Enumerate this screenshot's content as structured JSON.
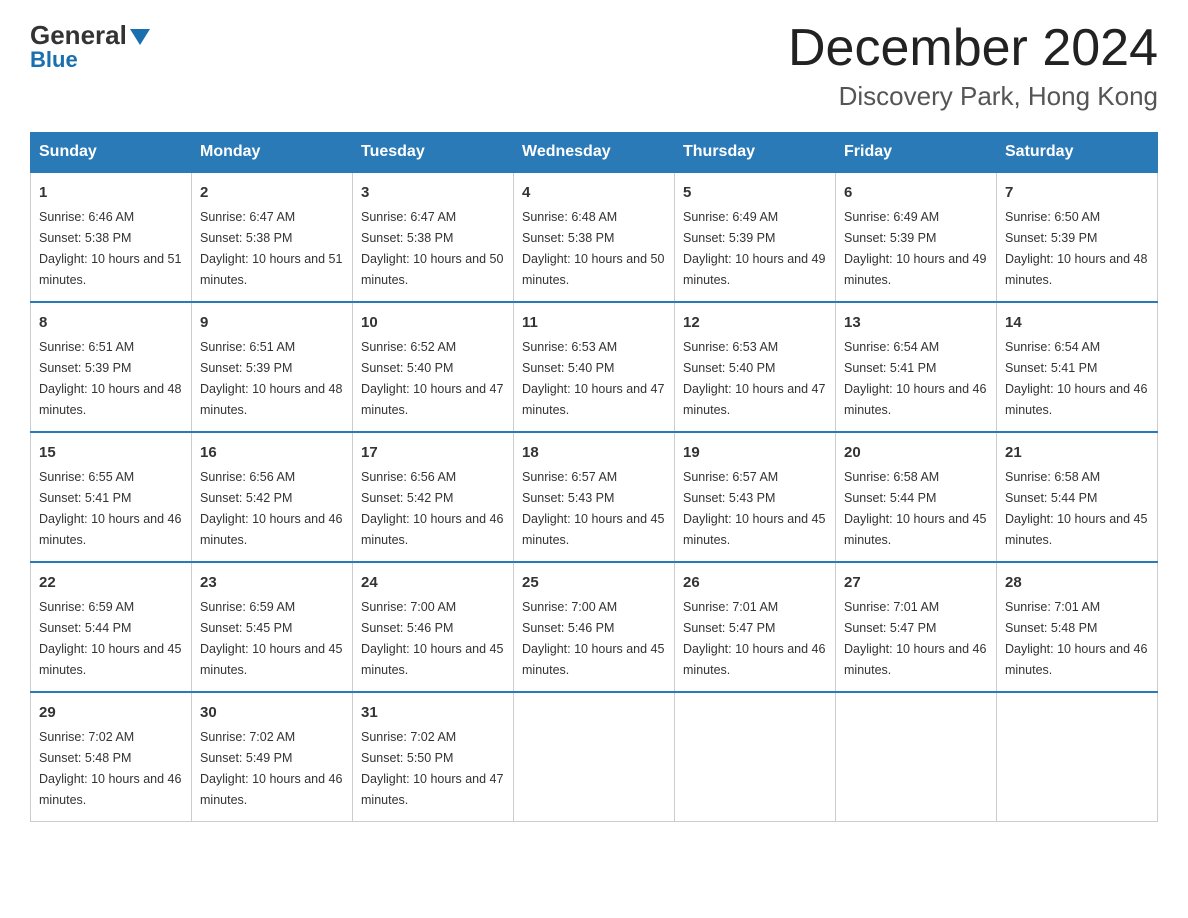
{
  "header": {
    "logo": {
      "general": "General",
      "blue": "Blue"
    },
    "title": "December 2024",
    "location": "Discovery Park, Hong Kong"
  },
  "days_of_week": [
    "Sunday",
    "Monday",
    "Tuesday",
    "Wednesday",
    "Thursday",
    "Friday",
    "Saturday"
  ],
  "weeks": [
    [
      {
        "day": "1",
        "sunrise": "6:46 AM",
        "sunset": "5:38 PM",
        "daylight": "10 hours and 51 minutes."
      },
      {
        "day": "2",
        "sunrise": "6:47 AM",
        "sunset": "5:38 PM",
        "daylight": "10 hours and 51 minutes."
      },
      {
        "day": "3",
        "sunrise": "6:47 AM",
        "sunset": "5:38 PM",
        "daylight": "10 hours and 50 minutes."
      },
      {
        "day": "4",
        "sunrise": "6:48 AM",
        "sunset": "5:38 PM",
        "daylight": "10 hours and 50 minutes."
      },
      {
        "day": "5",
        "sunrise": "6:49 AM",
        "sunset": "5:39 PM",
        "daylight": "10 hours and 49 minutes."
      },
      {
        "day": "6",
        "sunrise": "6:49 AM",
        "sunset": "5:39 PM",
        "daylight": "10 hours and 49 minutes."
      },
      {
        "day": "7",
        "sunrise": "6:50 AM",
        "sunset": "5:39 PM",
        "daylight": "10 hours and 48 minutes."
      }
    ],
    [
      {
        "day": "8",
        "sunrise": "6:51 AM",
        "sunset": "5:39 PM",
        "daylight": "10 hours and 48 minutes."
      },
      {
        "day": "9",
        "sunrise": "6:51 AM",
        "sunset": "5:39 PM",
        "daylight": "10 hours and 48 minutes."
      },
      {
        "day": "10",
        "sunrise": "6:52 AM",
        "sunset": "5:40 PM",
        "daylight": "10 hours and 47 minutes."
      },
      {
        "day": "11",
        "sunrise": "6:53 AM",
        "sunset": "5:40 PM",
        "daylight": "10 hours and 47 minutes."
      },
      {
        "day": "12",
        "sunrise": "6:53 AM",
        "sunset": "5:40 PM",
        "daylight": "10 hours and 47 minutes."
      },
      {
        "day": "13",
        "sunrise": "6:54 AM",
        "sunset": "5:41 PM",
        "daylight": "10 hours and 46 minutes."
      },
      {
        "day": "14",
        "sunrise": "6:54 AM",
        "sunset": "5:41 PM",
        "daylight": "10 hours and 46 minutes."
      }
    ],
    [
      {
        "day": "15",
        "sunrise": "6:55 AM",
        "sunset": "5:41 PM",
        "daylight": "10 hours and 46 minutes."
      },
      {
        "day": "16",
        "sunrise": "6:56 AM",
        "sunset": "5:42 PM",
        "daylight": "10 hours and 46 minutes."
      },
      {
        "day": "17",
        "sunrise": "6:56 AM",
        "sunset": "5:42 PM",
        "daylight": "10 hours and 46 minutes."
      },
      {
        "day": "18",
        "sunrise": "6:57 AM",
        "sunset": "5:43 PM",
        "daylight": "10 hours and 45 minutes."
      },
      {
        "day": "19",
        "sunrise": "6:57 AM",
        "sunset": "5:43 PM",
        "daylight": "10 hours and 45 minutes."
      },
      {
        "day": "20",
        "sunrise": "6:58 AM",
        "sunset": "5:44 PM",
        "daylight": "10 hours and 45 minutes."
      },
      {
        "day": "21",
        "sunrise": "6:58 AM",
        "sunset": "5:44 PM",
        "daylight": "10 hours and 45 minutes."
      }
    ],
    [
      {
        "day": "22",
        "sunrise": "6:59 AM",
        "sunset": "5:44 PM",
        "daylight": "10 hours and 45 minutes."
      },
      {
        "day": "23",
        "sunrise": "6:59 AM",
        "sunset": "5:45 PM",
        "daylight": "10 hours and 45 minutes."
      },
      {
        "day": "24",
        "sunrise": "7:00 AM",
        "sunset": "5:46 PM",
        "daylight": "10 hours and 45 minutes."
      },
      {
        "day": "25",
        "sunrise": "7:00 AM",
        "sunset": "5:46 PM",
        "daylight": "10 hours and 45 minutes."
      },
      {
        "day": "26",
        "sunrise": "7:01 AM",
        "sunset": "5:47 PM",
        "daylight": "10 hours and 46 minutes."
      },
      {
        "day": "27",
        "sunrise": "7:01 AM",
        "sunset": "5:47 PM",
        "daylight": "10 hours and 46 minutes."
      },
      {
        "day": "28",
        "sunrise": "7:01 AM",
        "sunset": "5:48 PM",
        "daylight": "10 hours and 46 minutes."
      }
    ],
    [
      {
        "day": "29",
        "sunrise": "7:02 AM",
        "sunset": "5:48 PM",
        "daylight": "10 hours and 46 minutes."
      },
      {
        "day": "30",
        "sunrise": "7:02 AM",
        "sunset": "5:49 PM",
        "daylight": "10 hours and 46 minutes."
      },
      {
        "day": "31",
        "sunrise": "7:02 AM",
        "sunset": "5:50 PM",
        "daylight": "10 hours and 47 minutes."
      },
      null,
      null,
      null,
      null
    ]
  ]
}
